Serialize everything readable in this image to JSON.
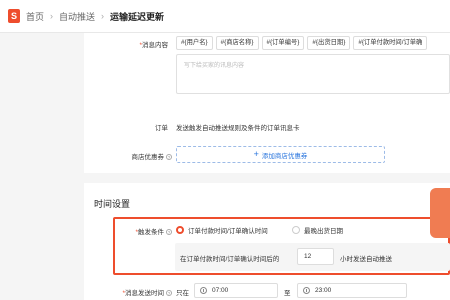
{
  "breadcrumb": {
    "logo": "S",
    "home": "首页",
    "sep1": "›",
    "auto_push": "自动推送",
    "sep2": "›",
    "current": "运输延迟更新"
  },
  "message": {
    "label_req": "*",
    "label": "消息内容",
    "tags": [
      "#{用户名}",
      "#{商店名称}",
      "#{订单编号}",
      "#{出货日期}",
      "#{订单付款时间/订单确"
    ],
    "placeholder": "写下给买家的讯息内容"
  },
  "order": {
    "label": "订单",
    "text": "发送触发自动推送规则及条件的订单讯息卡"
  },
  "coupon": {
    "label": "商店优惠券",
    "help": "?",
    "button": "添加商店优惠券",
    "plus": "+"
  },
  "time_settings": {
    "title": "时间设置",
    "trigger_req": "*",
    "trigger_label": "触发条件",
    "trigger_help": "?",
    "option1": "订单付款时间/订单确认时间",
    "option2": "最晚出货日期",
    "selected_option": "option1",
    "prefix": "在订单付款时间/订单确认时间后的",
    "hours": "12",
    "suffix": "小时发送自动推送",
    "send_req": "*",
    "send_label": "消息发送时间",
    "send_help": "?",
    "only_in": "只在",
    "start_time": "07:00",
    "to": "至",
    "end_time": "23:00"
  },
  "colors": {
    "accent": "#ee4d2d",
    "link": "#2673dd",
    "float_tab": "#f07c52"
  }
}
